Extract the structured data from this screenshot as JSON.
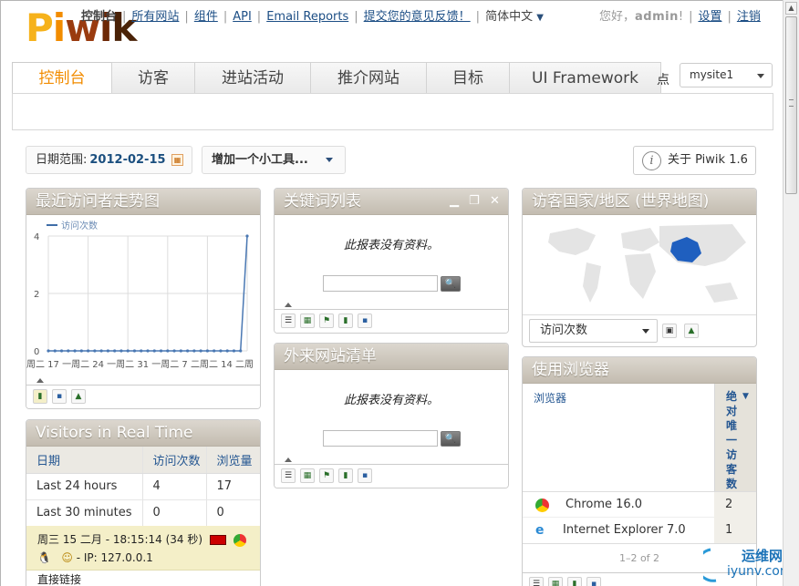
{
  "header": {
    "logo_text": "Piwik",
    "nav_current": "控制台",
    "nav_links": [
      "所有网站",
      "组件",
      "API",
      "Email Reports",
      "提交您的意见反馈！"
    ],
    "language": "简体中文",
    "greeting": "您好，",
    "username": "admin",
    "greeting_end": "!",
    "settings_link": "设置",
    "logout_link": "注销"
  },
  "tabs": [
    "控制台",
    "访客",
    "进站活动",
    "推介网站",
    "目标",
    "UI Framework"
  ],
  "tab_tail_fragment": "点",
  "site_select": "mysite1",
  "toolbar": {
    "date_label": "日期范围:",
    "date_value": "2012-02-15",
    "add_widget": "增加一个小工具...",
    "about": "关于 Piwik 1.6"
  },
  "widgets": {
    "visits_over_time": {
      "title": "最近访问者走势图",
      "legend": "访问次数",
      "x_tick_row": "周二 17 一周二 24 一周二 31 一周二 7 二周二 14 二周"
    },
    "keywords": {
      "title": "关键词列表",
      "no_data": "此报表没有资料。",
      "search_button": "🔍"
    },
    "referrers": {
      "title": "外来网站清单",
      "no_data": "此报表没有资料。",
      "search_button": "🔍"
    },
    "map": {
      "title": "访客国家/地区 (世界地图)",
      "metric_select": "访问次数"
    },
    "realtime": {
      "title": "Visitors in Real Time",
      "headers": [
        "日期",
        "访问次数",
        "浏览量"
      ],
      "rows": [
        {
          "period": "Last 24 hours",
          "visits": "4",
          "pageviews": "17"
        },
        {
          "period": "Last 30 minutes",
          "visits": "0",
          "pageviews": "0"
        }
      ],
      "last_visit_time": "周三 15 二月 - 18:15:14 (34 秒)",
      "last_visit_ip": "- IP: 127.0.0.1",
      "last_visit_referrer": "直接链接"
    },
    "browsers": {
      "title": "使用浏览器",
      "col_label": "浏览器",
      "col_value": "绝对唯一访客数",
      "rows": [
        {
          "name": "Chrome 16.0",
          "value": "2"
        },
        {
          "name": "Internet Explorer 7.0",
          "value": "1"
        }
      ],
      "pagination": "1–2 of 2"
    }
  },
  "watermark": {
    "cn": "运维网",
    "en": "iyunv.com"
  },
  "colors": {
    "accent": "#f28c00",
    "link": "#1c4e85",
    "widget_header": "#c9c2b6",
    "china": "#1f5fbf"
  },
  "chart_data": {
    "type": "line",
    "legend": "访问次数",
    "ylim": [
      0,
      4
    ],
    "y_ticks": [
      "4",
      "2",
      "0"
    ],
    "values": [
      0,
      0,
      0,
      0,
      0,
      0,
      0,
      0,
      0,
      0,
      0,
      0,
      0,
      0,
      0,
      0,
      0,
      0,
      0,
      0,
      0,
      0,
      0,
      0,
      0,
      0,
      0,
      0,
      0,
      0,
      4
    ],
    "grid": true
  }
}
